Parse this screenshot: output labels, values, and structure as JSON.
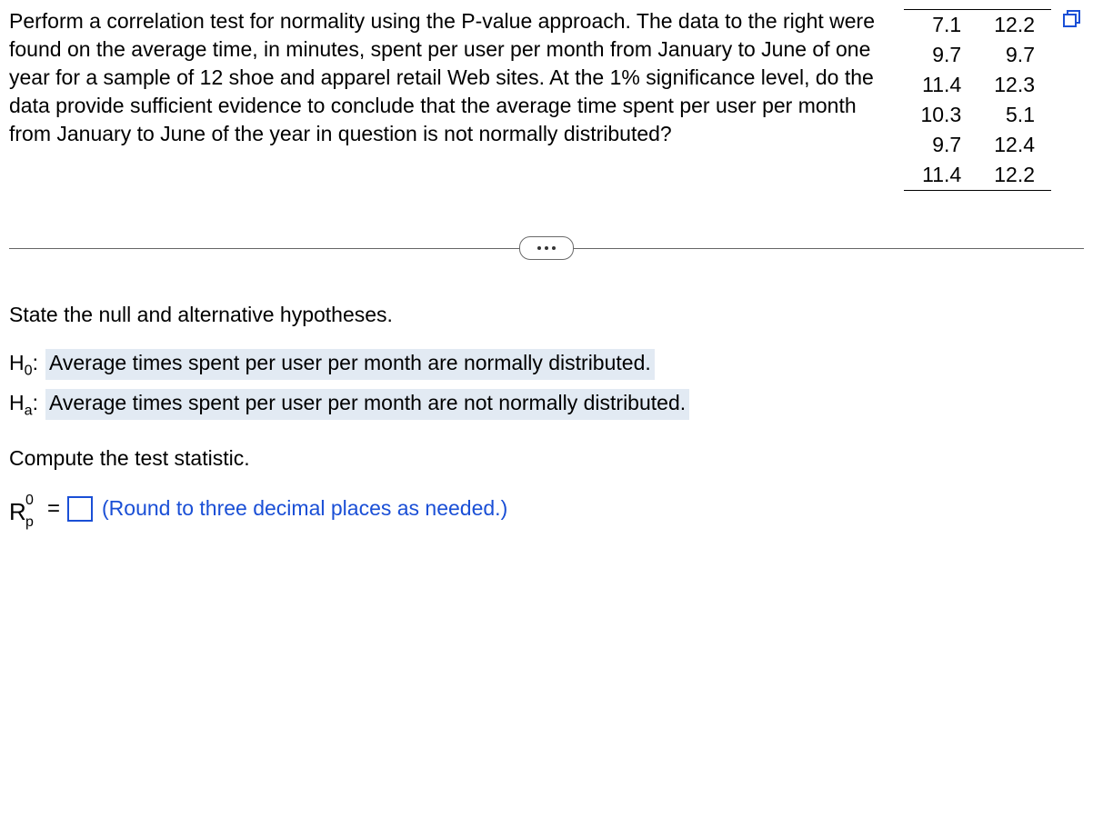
{
  "problem": {
    "text": "Perform a correlation test for normality using the P-value approach. The data to the right were found on the average time, in minutes, spent per user per month from January to June of one year for a sample of 12 shoe and apparel retail Web sites. At the 1% significance level, do the data provide sufficient evidence to conclude that the average time spent per user per month from January to June of the year in question is not normally distributed?"
  },
  "data_table": {
    "rows": [
      {
        "c1": "7.1",
        "c2": "12.2"
      },
      {
        "c1": "9.7",
        "c2": "9.7"
      },
      {
        "c1": "11.4",
        "c2": "12.3"
      },
      {
        "c1": "10.3",
        "c2": "5.1"
      },
      {
        "c1": "9.7",
        "c2": "12.4"
      },
      {
        "c1": "11.4",
        "c2": "12.2"
      }
    ]
  },
  "prompts": {
    "state_hypotheses": "State the null and alternative hypotheses.",
    "compute_stat": "Compute the test statistic.",
    "round_note": "(Round to three decimal places as needed.)"
  },
  "hypotheses": {
    "h0_label": "H",
    "h0_sub": "0",
    "h0_colon": ":",
    "h0_text": "Average times spent per user per month are normally distributed.",
    "ha_label": "H",
    "ha_sub": "a",
    "ha_colon": ":",
    "ha_text": "Average times spent per user per month are not normally distributed."
  },
  "statistic": {
    "R": "R",
    "sup": "0",
    "sub": "p",
    "equals": "=",
    "value": ""
  }
}
